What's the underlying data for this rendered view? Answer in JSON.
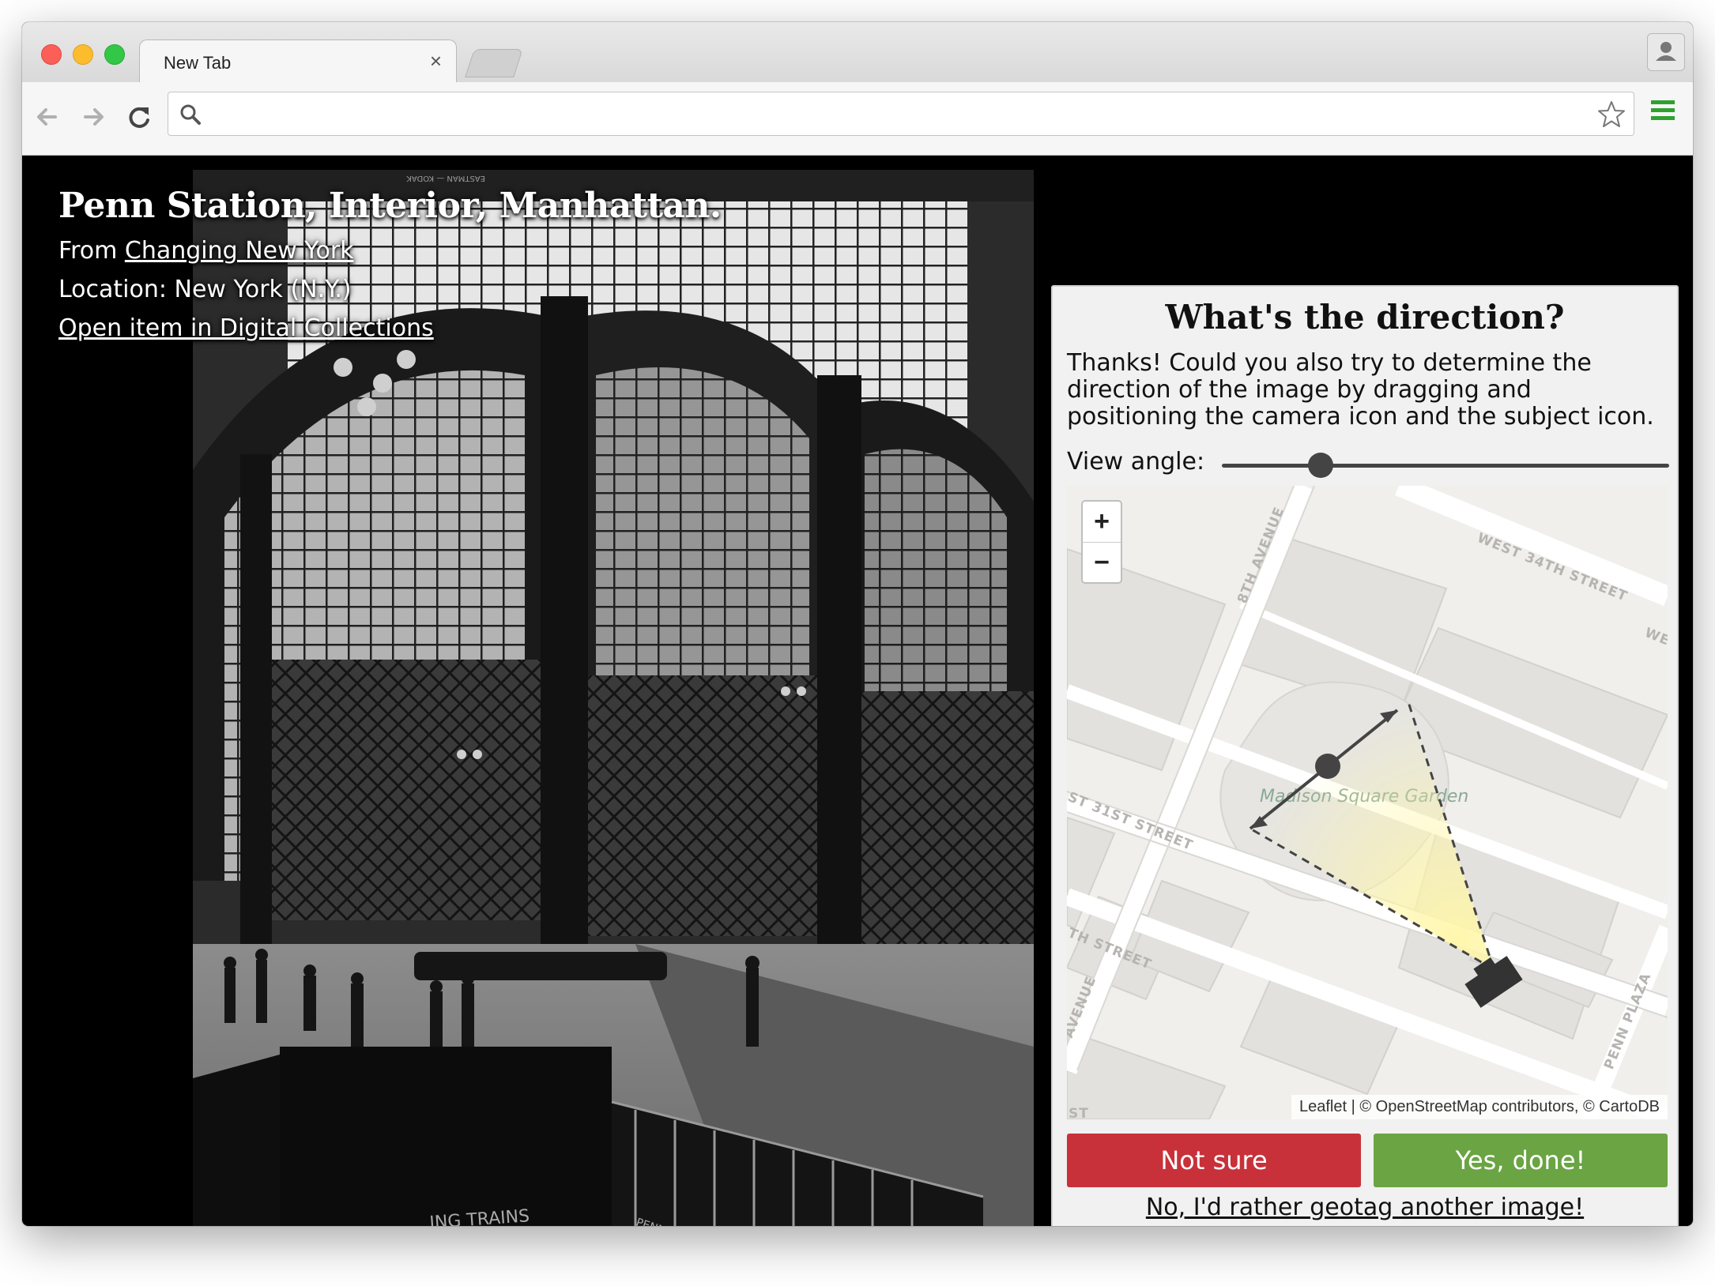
{
  "browser": {
    "tab_title": "New Tab",
    "tab_close": "×",
    "address_value": "",
    "address_placeholder": ""
  },
  "image_info": {
    "title": "Penn Station, Interior, Manhattan.",
    "from_prefix": "From ",
    "collection_link": "Changing New York",
    "location": "Location: New York (N.Y.)",
    "open_link": "Open item in Digital Collections"
  },
  "panel": {
    "heading": "What's the direction?",
    "description": "Thanks! Could you also try to determine the direction of the image by dragging and positioning the camera icon and the subject icon.",
    "view_angle_label": "View angle:",
    "view_angle_value": 0.22,
    "zoom_in": "+",
    "zoom_out": "−",
    "attribution": "Leaflet | © OpenStreetMap contributors, © CartoDB",
    "not_sure": "Not sure",
    "yes_done": "Yes, done!",
    "skip": "No, I'd rather geotag another image!"
  },
  "map_labels": {
    "avenue_8th": "8TH AVENUE",
    "street_34th": "WEST 34TH STREET",
    "street_34th_tail": "WE",
    "street_31st": "ST 31ST STREET",
    "street_other": "TH STREET",
    "avenue_other": "AVENUE",
    "penn_plaza": "PENN PLAZA",
    "madison": "Madison Square Garden",
    "st_bottom": "ST"
  },
  "colors": {
    "not_sure_bg": "#c8313a",
    "yes_bg": "#6aa443",
    "menu_green": "#2fa12f"
  },
  "photo_signs": {
    "top": "EASTMAN — KODAK",
    "trains": "ING TRAINS",
    "penn": "PENNSYL"
  }
}
